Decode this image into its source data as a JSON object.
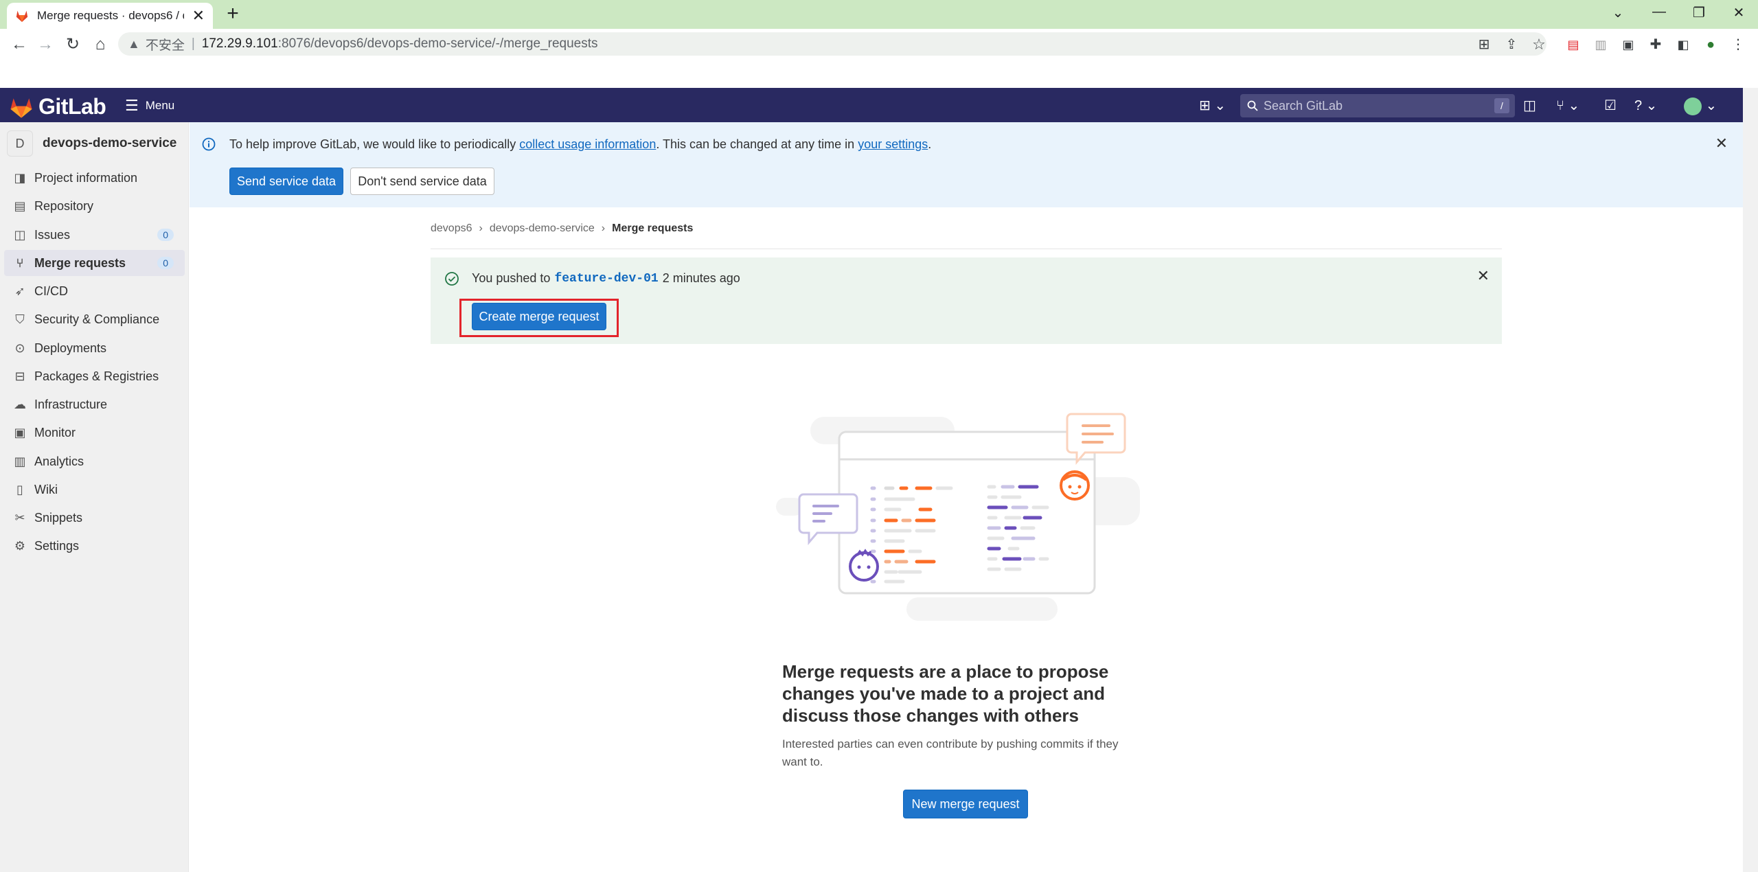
{
  "browser": {
    "tab_title": "Merge requests · devops6 / de",
    "insecure_label": "不安全",
    "url_host": "172.29.9.101",
    "url_path": ":8076/devops6/devops-demo-service/-/merge_requests"
  },
  "header": {
    "brand": "GitLab",
    "menu_label": "Menu",
    "search_placeholder": "Search GitLab",
    "search_shortcut": "/"
  },
  "sidebar": {
    "project_initial": "D",
    "project_name": "devops-demo-service",
    "items": [
      {
        "label": "Project information"
      },
      {
        "label": "Repository"
      },
      {
        "label": "Issues",
        "badge": "0"
      },
      {
        "label": "Merge requests",
        "badge": "0"
      },
      {
        "label": "CI/CD"
      },
      {
        "label": "Security & Compliance"
      },
      {
        "label": "Deployments"
      },
      {
        "label": "Packages & Registries"
      },
      {
        "label": "Infrastructure"
      },
      {
        "label": "Monitor"
      },
      {
        "label": "Analytics"
      },
      {
        "label": "Wiki"
      },
      {
        "label": "Snippets"
      },
      {
        "label": "Settings"
      }
    ]
  },
  "banner": {
    "text_before": "To help improve GitLab, we would like to periodically ",
    "link1": "collect usage information",
    "text_middle": ". This can be changed at any time in ",
    "link2": "your settings",
    "text_after": ".",
    "send_button": "Send service data",
    "dont_send_button": "Don't send service data"
  },
  "breadcrumb": {
    "group": "devops6",
    "project": "devops-demo-service",
    "current": "Merge requests"
  },
  "push_alert": {
    "prefix": "You pushed to",
    "branch": "feature-dev-01",
    "time": "2 minutes ago",
    "button": "Create merge request"
  },
  "empty_state": {
    "title": "Merge requests are a place to propose changes you've made to a project and discuss those changes with others",
    "description": "Interested parties can even contribute by pushing commits if they want to.",
    "button": "New merge request"
  },
  "colors": {
    "header_bg": "#292961",
    "primary": "#1f75cb",
    "banner_bg": "#e9f3fc",
    "success_bg": "#ecf4ee",
    "highlight": "#e3242b"
  }
}
